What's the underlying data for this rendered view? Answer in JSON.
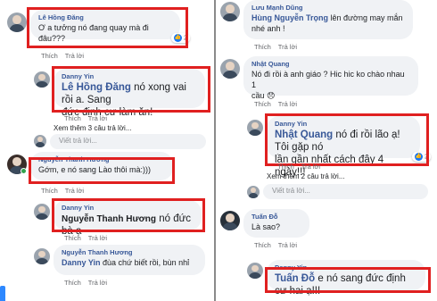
{
  "actions": {
    "like": "Thích",
    "reply": "Trả lời"
  },
  "reply_placeholder": "Viết trả lời...",
  "left": {
    "c1": {
      "author": "Lê Hồng Đăng",
      "text": "Ơ a tưởng nó đang quay mà đi đâu???",
      "reactions": "2"
    },
    "c2": {
      "author": "Danny Yin",
      "mention": "Lê Hồng Đăng",
      "text_a": " nó xong vai rồi a. Sang",
      "text_b": "đức định cư làm ăn!"
    },
    "more1": "Xem thêm 3 câu trả lời...",
    "c3": {
      "author": "Nguyễn Thanh Hương",
      "text": "Gớm, e nó sang Lào thôi mà:)))"
    },
    "c4": {
      "author": "Danny Yin",
      "mention": "Nguyễn Thanh Hương",
      "text": " nó đức bà ạ"
    },
    "c5": {
      "author": "Nguyễn Thanh Hương",
      "mention": "Danny Yin",
      "text": " đùa chứ biết rồi, bùn nhỉ"
    }
  },
  "right": {
    "c1": {
      "author": "Lưu Mạnh Dũng",
      "mention": "Hùng Nguyễn Trọng",
      "text_a": " lên đường may mắn",
      "text_b": "nhé anh !"
    },
    "c2": {
      "author": "Nhật Quang",
      "text_a": "Nó đi rồi à anh giáo ? Hic hic ko chào nhau 1",
      "text_b": "cầu",
      "emoji": "😞"
    },
    "c3": {
      "author": "Danny Yin",
      "mention": "Nhật Quang",
      "text_a": " nó đi rồi lão ạ! Tôi gặp nó",
      "text_b": "lần gần nhất cách đây 4 ngày!!!",
      "reactions": "2"
    },
    "more1": "Xem thêm 2 câu trả lời...",
    "c4": {
      "author": "Tuấn Đỗ",
      "text": "Là sao?"
    },
    "c5": {
      "author": "Danny Yin",
      "mention": "Tuấn Đỗ",
      "text": " e nó sang đức định cư hai ạ!!!"
    }
  }
}
